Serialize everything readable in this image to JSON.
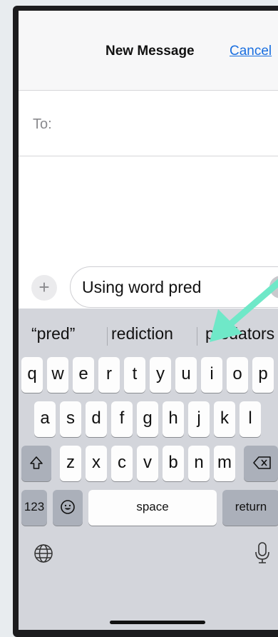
{
  "header": {
    "title": "New Message",
    "cancel_label": "Cancel"
  },
  "to": {
    "label": "To:"
  },
  "compose": {
    "plus_label": "+",
    "message_text": "Using word pred"
  },
  "suggestions": [
    "“pred”",
    "rediction",
    "predators"
  ],
  "keyboard": {
    "row1": [
      "q",
      "w",
      "e",
      "r",
      "t",
      "y",
      "u",
      "i",
      "o",
      "p"
    ],
    "row2": [
      "a",
      "s",
      "d",
      "f",
      "g",
      "h",
      "j",
      "k",
      "l"
    ],
    "row3": [
      "z",
      "x",
      "c",
      "v",
      "b",
      "n",
      "m"
    ],
    "numbers_label": "123",
    "space_label": "space",
    "return_label": "return"
  },
  "icons": {
    "shift": "shift-icon",
    "backspace": "backspace-icon",
    "emoji": "emoji-icon",
    "globe": "globe-icon",
    "mic": "microphone-icon",
    "annotation": "arrow-annotation"
  },
  "colors": {
    "accent": "#1a6fe0",
    "arrow": "#6fe8c8",
    "keyboard_bg": "#d3d5db"
  }
}
